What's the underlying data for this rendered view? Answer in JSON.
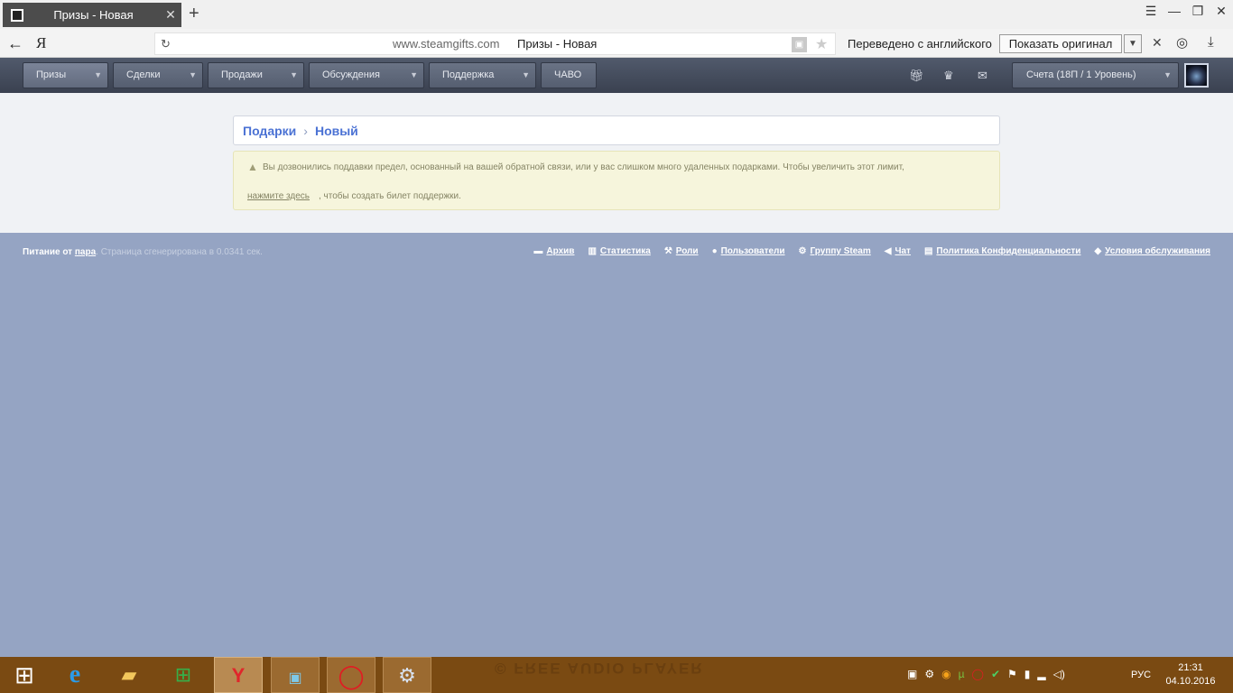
{
  "browser": {
    "tab_title": "Призы - Новая",
    "new_tab": "+",
    "url_host": "www.steamgifts.com",
    "url_title": "Призы - Новая",
    "logo": "Я",
    "translated_text": "Переведено с английского",
    "show_original": "Показать оригинал"
  },
  "nav": {
    "items": [
      {
        "label": "Призы"
      },
      {
        "label": "Сделки"
      },
      {
        "label": "Продажи"
      },
      {
        "label": "Обсуждения"
      },
      {
        "label": "Поддержка"
      },
      {
        "label": "ЧАВО"
      }
    ],
    "account": "Счета (18П / 1 Уровень)",
    "icons": [
      "gift-icon",
      "trophy-icon",
      "mail-icon"
    ]
  },
  "breadcrumb": {
    "root": "Подарки",
    "current": "Новый"
  },
  "notice": {
    "message": "Вы дозвонились поддавки предел, основанный на вашей обратной связи, или у вас слишком много удаленных подарками. Чтобы увеличить этот лимит,",
    "link": "нажмите здесь",
    "rest": ", чтобы создать билет поддержки."
  },
  "footer": {
    "powered_label": "Питание от",
    "powered_link": "пара",
    "generated": ". Страница сгенерирована в 0.0341 сек.",
    "links": [
      "Архив",
      "Статистика",
      "Роли",
      "Пользователи",
      "Группу Steam",
      "Чат",
      "Политика Конфиденциальности",
      "Условия обслуживания"
    ]
  },
  "taskbar": {
    "ghost_text": "© FREE AUDIO PLAYER",
    "lang": "РУС",
    "time": "21:31",
    "date": "04.10.2016"
  }
}
